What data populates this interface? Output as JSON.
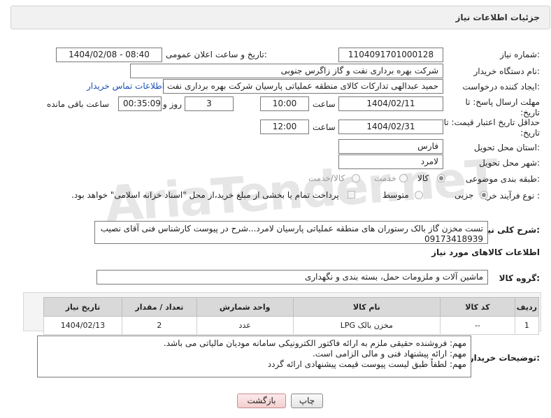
{
  "header": {
    "title": "جزئیات اطلاعات نیاز"
  },
  "fields": {
    "need_number_label": "شماره نیاز:",
    "need_number": "1104091701000128",
    "announce_label": "تاریخ و ساعت اعلان عمومی:",
    "announce_value": "1404/02/08 - 08:40",
    "buyer_org_label": "نام دستگاه خریدار:",
    "buyer_org": "شرکت بهره برداری نفت و گاز زاگرس جنوبی",
    "creator_label": "ایجاد کننده درخواست:",
    "creator": "حمید عبدالهی تدارکات کالای منطقه عملیاتی پارسیان شرکت بهره برداری نفت و",
    "contact_link": "اطلاعات تماس خریدار",
    "deadline_label": "مهلت ارسال پاسخ: تا تاریخ:",
    "deadline_date": "1404/02/11",
    "time_label": "ساعت",
    "deadline_time": "10:00",
    "days": "3",
    "days_label": "روز و",
    "remaining": "00:35:09",
    "remaining_label": "ساعت باقی مانده",
    "validity_label": "حداقل تاریخ اعتبار قیمت: تا تاریخ:",
    "validity_date": "1404/02/31",
    "validity_time_label": "ساعت",
    "validity_time": "12:00",
    "province_label": "استان محل تحویل:",
    "province": "فارس",
    "city_label": "شهر محل تحویل:",
    "city": "لامرد",
    "category_label": "طبقه بندی موضوعی:",
    "category_options": [
      "کالا",
      "خدمت",
      "کالا/خدمت"
    ],
    "purchase_type_label": "نوع فرآیند خرید :",
    "purchase_type_options": [
      "جزیی",
      "متوسط"
    ],
    "payment_note": "پرداخت تمام یا بخشی از مبلغ خرید،از محل \"اسناد خزانه اسلامی\" خواهد بود.",
    "summary_label": "شرح کلی نیاز:",
    "summary": "تست مخزن گاز بالک رستوران های منطقه عملیاتی پارسیان لامرد...شرح در پیوست کارشناس فنی آقای نصیب 09173418939",
    "goods_info_title": "اطلاعات کالاهای مورد نیاز",
    "goods_group_label": "گروه کالا:",
    "goods_group": "ماشین آلات و ملزومات حمل، بسته بندی و نگهداری",
    "buyer_notes_label": "توضیحات خریدار:",
    "buyer_notes": [
      "مهم: فروشنده حقیقی ملزم به ارائه فاکتور الکترونیکی سامانه مودیان مالیاتی می باشد.",
      "مهم: ارائه پیشنهاد فنی و مالی الزامی است.",
      "مهم: لطفاً طبق لیست پیوست قیمت پیشنهادی ارائه گردد"
    ]
  },
  "watermark": "AriaTender.neT",
  "table": {
    "headers": [
      "ردیف",
      "کد کالا",
      "نام کالا",
      "واحد شمارش",
      "تعداد / مقدار",
      "تاریخ نیاز"
    ],
    "rows": [
      [
        "1",
        "--",
        "مخزن بالک LPG",
        "عدد",
        "2",
        "1404/02/13"
      ]
    ]
  },
  "buttons": {
    "print": "چاپ",
    "back": "بازگشت"
  }
}
